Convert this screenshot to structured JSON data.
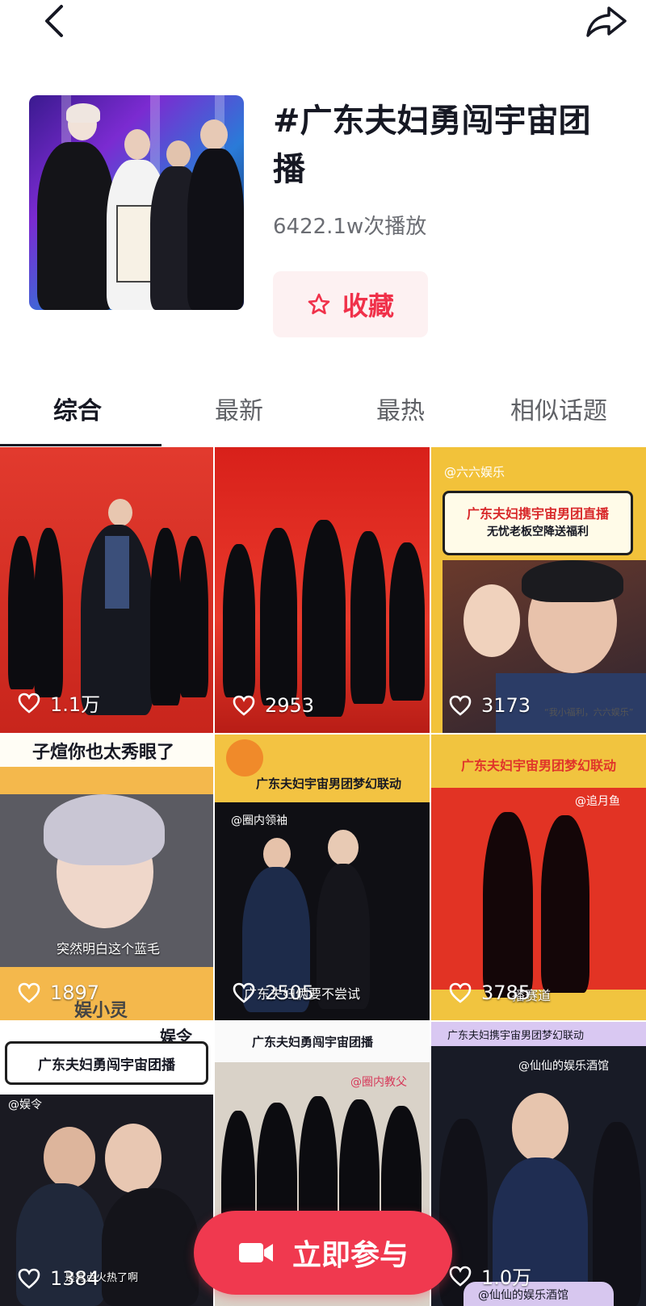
{
  "header": {
    "back_icon": "chevron-left-icon",
    "share_icon": "share-arrow-icon"
  },
  "topic": {
    "title": "#广东夫妇勇闯宇宙团播",
    "plays": "6422.1w次播放",
    "favorite_label": "收藏",
    "favorite_icon": "star-outline-icon"
  },
  "tabs": [
    {
      "label": "综合",
      "active": true
    },
    {
      "label": "最新",
      "active": false
    },
    {
      "label": "最热",
      "active": false
    },
    {
      "label": "相似话题",
      "active": false
    }
  ],
  "videos": [
    {
      "likes": "1.1万",
      "texts": []
    },
    {
      "likes": "2953",
      "texts": []
    },
    {
      "likes": "3173",
      "texts": [
        "@六六娱乐",
        "广东夫妇携宇宙男团直播",
        "无忧老板空降送福利",
        "“我小福利，六六娱乐”"
      ]
    },
    {
      "likes": "1897",
      "texts": [
        "子煊你也太秀眼了",
        "突然明白这个蓝毛",
        "娱小灵"
      ]
    },
    {
      "likes": "2505",
      "texts": [
        "广东夫妇宇宙男团梦幻联动",
        "@圈内领袖",
        "广东夫妇俩要不尝试"
      ]
    },
    {
      "likes": "3785",
      "texts": [
        "广东夫妇宇宙男团梦幻联动",
        "@追月鱼",
        "播赛道"
      ]
    },
    {
      "likes": "1384",
      "texts": [
        "娱令",
        "广东夫妇勇闯宇宙团播",
        "@娱令",
        "是有点火热了啊"
      ]
    },
    {
      "likes": "",
      "texts": [
        "广东夫妇勇闯宇宙团播",
        "@圈内教父"
      ]
    },
    {
      "likes": "1.0万",
      "texts": [
        "广东夫妇携宇宙男团梦幻联动",
        "@仙仙的娱乐酒馆",
        "@仙仙的娱乐酒馆"
      ]
    }
  ],
  "cta": {
    "label": "立即参与",
    "icon": "video-camera-icon"
  },
  "colors": {
    "accent": "#f0394f",
    "favorite_bg": "#fdf1f2",
    "text_primary": "#161823",
    "text_secondary": "#6b6d73"
  }
}
